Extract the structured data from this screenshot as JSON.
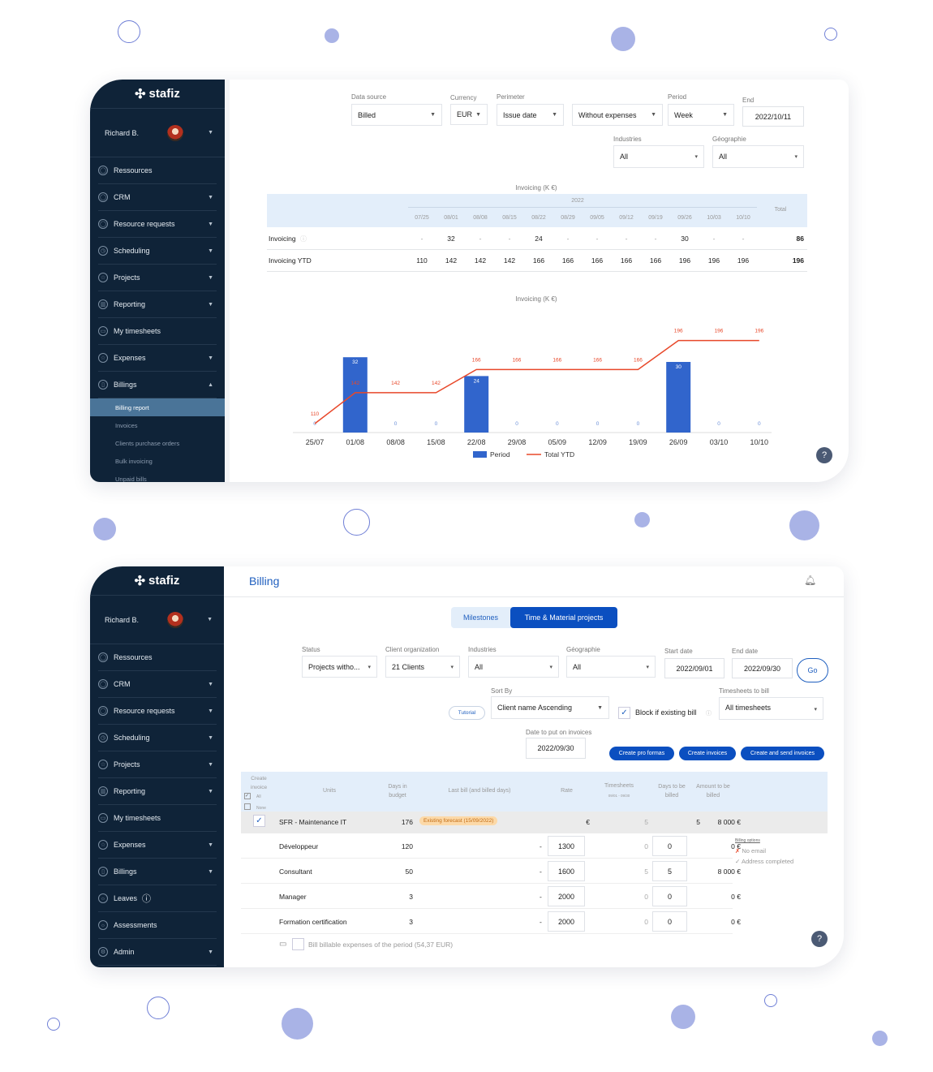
{
  "brand": "stafiz",
  "user": "Richard B.",
  "colors": {
    "sidebar": "#0f2338",
    "accent": "#0b4fc0",
    "bar": "#3165cc",
    "line": "#e8482a",
    "header_band": "#e3eefa"
  },
  "report": {
    "sidebar": [
      {
        "label": "Ressources",
        "icon": "user-icon",
        "caret": false
      },
      {
        "label": "CRM",
        "icon": "user-icon",
        "caret": true
      },
      {
        "label": "Resource requests",
        "icon": "user-icon",
        "caret": true
      },
      {
        "label": "Scheduling",
        "icon": "clock-icon",
        "caret": true
      },
      {
        "label": "Projects",
        "icon": "star-icon",
        "caret": true
      },
      {
        "label": "Reporting",
        "icon": "chart-icon",
        "caret": true
      },
      {
        "label": "My timesheets",
        "icon": "calendar-icon",
        "caret": false
      },
      {
        "label": "Expenses",
        "icon": "star-icon",
        "caret": true
      },
      {
        "label": "Billings",
        "icon": "document-icon",
        "caret": true,
        "open": true
      }
    ],
    "submenu": [
      "Billing report",
      "Invoices",
      "Clients purchase orders",
      "Bulk invoicing",
      "Unpaid bills"
    ],
    "filters": {
      "data_source": {
        "label": "Data source",
        "value": "Billed"
      },
      "currency": {
        "label": "Currency",
        "value": "EUR"
      },
      "perimeter": {
        "label": "Perimeter",
        "value": "Issue date"
      },
      "expenses": {
        "value": "Without expenses"
      },
      "period": {
        "label": "Period",
        "value": "Week"
      },
      "end": {
        "label": "End",
        "value": "2022/10/11"
      },
      "industries": {
        "label": "Industries",
        "value": "All"
      },
      "geographie": {
        "label": "Géographie",
        "value": "All"
      }
    },
    "table": {
      "title": "Invoicing (K €)",
      "year": "2022",
      "weeks": [
        "07/25",
        "08/01",
        "08/08",
        "08/15",
        "08/22",
        "08/29",
        "09/05",
        "09/12",
        "09/19",
        "09/26",
        "10/03",
        "10/10"
      ],
      "total_label": "Total",
      "rows": [
        {
          "label": "Invoicing",
          "values": [
            "-",
            "32",
            "-",
            "-",
            "24",
            "-",
            "-",
            "-",
            "-",
            "30",
            "-",
            "-"
          ],
          "total": "86"
        },
        {
          "label": "Invoicing YTD",
          "values": [
            "110",
            "142",
            "142",
            "142",
            "166",
            "166",
            "166",
            "166",
            "166",
            "196",
            "196",
            "196"
          ],
          "total": "196"
        }
      ]
    }
  },
  "chart_data": {
    "type": "bar",
    "title": "Invoicing (K €)",
    "categories": [
      "25/07",
      "01/08",
      "08/08",
      "15/08",
      "22/08",
      "29/08",
      "05/09",
      "12/09",
      "19/09",
      "26/09",
      "03/10",
      "10/10"
    ],
    "series": [
      {
        "name": "Period",
        "type": "bar",
        "values": [
          0,
          32,
          0,
          0,
          24,
          0,
          0,
          0,
          0,
          30,
          0,
          0
        ]
      },
      {
        "name": "Total YTD",
        "type": "line",
        "values": [
          110,
          142,
          142,
          142,
          166,
          166,
          166,
          166,
          166,
          196,
          196,
          196
        ]
      }
    ],
    "legend": "bottom",
    "grid": false
  },
  "billing": {
    "title": "Billing",
    "sidebar": [
      {
        "label": "Ressources",
        "icon": "user-icon",
        "caret": false
      },
      {
        "label": "CRM",
        "icon": "user-icon",
        "caret": true
      },
      {
        "label": "Resource requests",
        "icon": "user-icon",
        "caret": true
      },
      {
        "label": "Scheduling",
        "icon": "clock-icon",
        "caret": true
      },
      {
        "label": "Projects",
        "icon": "star-icon",
        "caret": true
      },
      {
        "label": "Reporting",
        "icon": "chart-icon",
        "caret": true
      },
      {
        "label": "My timesheets",
        "icon": "calendar-icon",
        "caret": false
      },
      {
        "label": "Expenses",
        "icon": "star-icon",
        "caret": true
      },
      {
        "label": "Billings",
        "icon": "document-icon",
        "caret": true
      },
      {
        "label": "Leaves",
        "icon": "sun-icon",
        "caret": false
      },
      {
        "label": "Assessments",
        "icon": "sun-icon",
        "caret": false
      },
      {
        "label": "Admin",
        "icon": "gear-icon",
        "caret": true
      }
    ],
    "tabs": [
      "Milestones",
      "Time & Material projects"
    ],
    "filters": {
      "status": {
        "label": "Status",
        "value": "Projects witho..."
      },
      "client": {
        "label": "Client organization",
        "value": "21 Clients"
      },
      "industries": {
        "label": "Industries",
        "value": "All"
      },
      "geographie": {
        "label": "Géographie",
        "value": "All"
      },
      "start": {
        "label": "Start date",
        "value": "2022/09/01"
      },
      "end": {
        "label": "End date",
        "value": "2022/09/30"
      },
      "go": "Go",
      "sort": {
        "label": "Sort By",
        "value": "Client name Ascending"
      },
      "tutorial": "Tutorial",
      "block": "Block if existing bill",
      "timesheets": {
        "label": "Timesheets to bill",
        "value": "All timesheets"
      },
      "date_invoice": {
        "label": "Date to put on invoices",
        "value": "2022/09/30"
      }
    },
    "actions": [
      "Create pro formas",
      "Create invoices",
      "Create and send invoices"
    ],
    "table": {
      "headers": {
        "create": "Create invoice",
        "all": "All",
        "none": "None",
        "units": "Units",
        "days_budget": "Days in budget",
        "last_bill": "Last bill (and billed days)",
        "rate": "Rate",
        "timesheets": "Timesheets",
        "timesheets_range": "09/01 - 09/30",
        "days_billed": "Days to be billed",
        "amount": "Amount to be billed"
      },
      "project": {
        "name": "SFR - Maintenance IT",
        "days": "176",
        "badge": "Existing forecast (15/09/2022)",
        "rate": "€",
        "timesheets": "5",
        "days_billed": "5",
        "amount": "8 000 €"
      },
      "rows": [
        {
          "unit": "Développeur",
          "days": "120",
          "last": "-",
          "rate": "1300",
          "timesheets": "0",
          "days_billed": "0",
          "amount": "0 €"
        },
        {
          "unit": "Consultant",
          "days": "50",
          "last": "-",
          "rate": "1600",
          "timesheets": "5",
          "days_billed": "5",
          "amount": "8 000 €"
        },
        {
          "unit": "Manager",
          "days": "3",
          "last": "-",
          "rate": "2000",
          "timesheets": "0",
          "days_billed": "0",
          "amount": "0 €"
        },
        {
          "unit": "Formation certification",
          "days": "3",
          "last": "-",
          "rate": "2000",
          "timesheets": "0",
          "days_billed": "0",
          "amount": "0 €"
        }
      ],
      "options": {
        "title": "Billing options",
        "no_email": "No email",
        "address": "Address completed"
      },
      "expenses": "Bill billable expenses of the period (54,37 EUR)"
    }
  }
}
